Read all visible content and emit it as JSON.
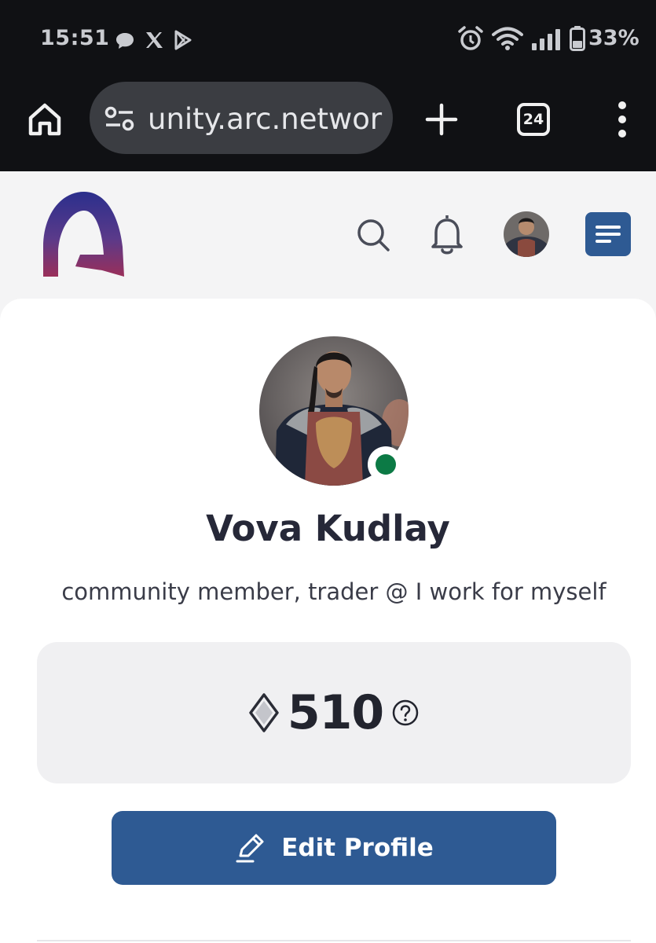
{
  "status_bar": {
    "time": "15:51",
    "battery": "33%",
    "notification_icons": [
      "chat-bubble-icon",
      "x-icon",
      "play-store-icon"
    ],
    "system_icons": [
      "alarm-icon",
      "wifi-icon",
      "signal-icon",
      "battery-icon"
    ]
  },
  "browser": {
    "url": "unity.arc.network",
    "tab_count": "24"
  },
  "site_header": {
    "logo": "arc-logo",
    "icons": [
      "search-icon",
      "bell-icon",
      "avatar",
      "menu-icon"
    ],
    "menu_color": "#2e5a93"
  },
  "profile": {
    "name": "Vova Kudlay",
    "bio": "community member, trader @ I work for myself",
    "online": true,
    "points": "510",
    "edit_button": "Edit Profile"
  },
  "colors": {
    "primary": "#2e5a93",
    "online": "#0c7a45",
    "logo_gradient": [
      "#2b2f8c",
      "#8d2f62"
    ]
  }
}
